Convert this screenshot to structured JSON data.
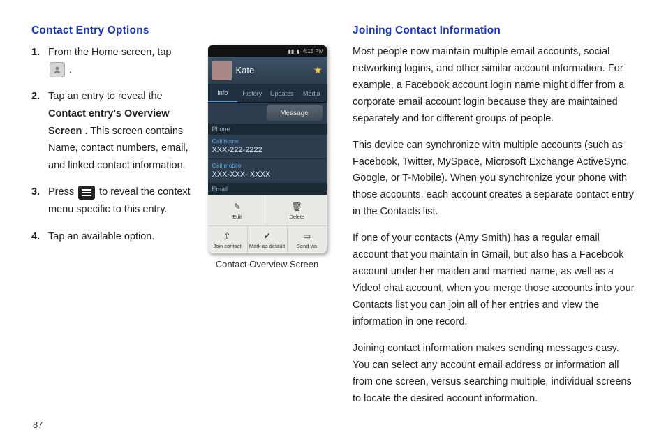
{
  "left": {
    "heading": "Contact Entry Options",
    "steps": {
      "s1_a": "From the Home screen, tap ",
      "s1_b": " .",
      "s2_a": "Tap an entry to reveal the ",
      "s2_bold": "Contact entry's Overview Screen",
      "s2_b": ". This screen contains Name, contact numbers, email, and linked contact information.",
      "s3_a": "Press ",
      "s3_b": " to reveal the context menu specific to this entry.",
      "s4": "Tap an available option."
    },
    "caption": "Contact Overview Screen"
  },
  "phone": {
    "status_time": "4:15 PM",
    "name": "Kate",
    "tabs": [
      "Info",
      "History",
      "Updates",
      "Media"
    ],
    "message_btn": "Message",
    "section_phone": "Phone",
    "row1_label": "Call home",
    "row1_value": "XXX-222-2222",
    "row2_label": "Call mobile",
    "row2_value": "XXX-XXX- XXXX",
    "section_email": "Email",
    "action_edit": "Edit",
    "action_delete": "Delete",
    "action_join": "Join contact",
    "action_mark": "Mark as default",
    "action_send": "Send via"
  },
  "right": {
    "heading": "Joining Contact Information",
    "p1": "Most people now maintain multiple email accounts, social networking logins, and other similar account information. For example, a Facebook account login name might differ from a corporate email account login because they are maintained separately and for different groups of people.",
    "p2": "This device can synchronize with multiple accounts (such as Facebook, Twitter, MySpace, Microsoft Exchange ActiveSync, Google, or T-Mobile). When you synchronize your phone with those accounts, each account creates a separate contact entry in the Contacts list.",
    "p3": "If one of your contacts (Amy Smith) has a regular email account that you maintain in Gmail, but also has a Facebook account under her maiden and married name, as well as a Video! chat account, when you merge those accounts into your Contacts list you can join all of her entries and view the information in one record.",
    "p4": "Joining contact information makes sending messages easy. You can select any account email address or information all from one screen, versus searching multiple, individual screens to locate the desired account information."
  },
  "page_number": "87"
}
